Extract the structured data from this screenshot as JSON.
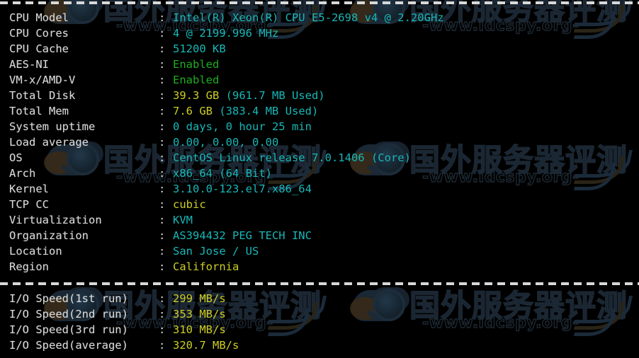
{
  "terminal": {
    "background_color": "#000000",
    "label_color": "#d9d9d9",
    "separator_char": "-",
    "colors": {
      "cyan": "#18b7b7",
      "green": "#1fae1f",
      "yellow": "#cdcd24",
      "white": "#d9d9d9"
    }
  },
  "watermark": {
    "chinese_text": "国外服务器评测",
    "url_text": "-www.idcspy.org-"
  },
  "system_info": {
    "separator_label": "dashed-separator",
    "rows": [
      {
        "label": "CPU Model",
        "separator": ":",
        "value": "Intel(R) Xeon(R) CPU E5-2698 v4 @ 2.20GHz",
        "color": "cyan"
      },
      {
        "label": "CPU Cores",
        "separator": ":",
        "value": "4 @ 2199.996 MHz",
        "color": "cyan"
      },
      {
        "label": "CPU Cache",
        "separator": ":",
        "value": "51200 KB",
        "color": "cyan"
      },
      {
        "label": "AES-NI",
        "separator": ":",
        "value": "Enabled",
        "color": "green"
      },
      {
        "label": "VM-x/AMD-V",
        "separator": ":",
        "value": "Enabled",
        "color": "green"
      },
      {
        "label": "Total Disk",
        "separator": ":",
        "value": "39.3 GB (961.7 MB Used)",
        "color": "yellow-cyan",
        "value_primary": "39.3 GB",
        "value_secondary": "(961.7 MB Used)"
      },
      {
        "label": "Total Mem",
        "separator": ":",
        "value": "7.6 GB (383.4 MB Used)",
        "color": "yellow-cyan",
        "value_primary": "7.6 GB",
        "value_secondary": "(383.4 MB Used)"
      },
      {
        "label": "System uptime",
        "separator": ":",
        "value": "0 days, 0 hour 25 min",
        "color": "cyan"
      },
      {
        "label": "Load average",
        "separator": ":",
        "value": "0.00, 0.00, 0.00",
        "color": "cyan"
      },
      {
        "label": "OS",
        "separator": ":",
        "value": "CentOS Linux release 7.0.1406 (Core)",
        "color": "cyan"
      },
      {
        "label": "Arch",
        "separator": ":",
        "value": "x86_64 (64 Bit)",
        "color": "cyan"
      },
      {
        "label": "Kernel",
        "separator": ":",
        "value": "3.10.0-123.el7.x86_64",
        "color": "cyan"
      },
      {
        "label": "TCP CC",
        "separator": ":",
        "value": "cubic",
        "color": "yellow"
      },
      {
        "label": "Virtualization",
        "separator": ":",
        "value": "KVM",
        "color": "cyan"
      },
      {
        "label": "Organization",
        "separator": ":",
        "value": "AS394432 PEG TECH INC",
        "color": "cyan"
      },
      {
        "label": "Location",
        "separator": ":",
        "value": "San Jose / US",
        "color": "cyan"
      },
      {
        "label": "Region",
        "separator": ":",
        "value": "California",
        "color": "yellow"
      }
    ]
  },
  "io_speed": {
    "rows": [
      {
        "label": "I/O Speed(1st run)",
        "separator": ":",
        "value": "299 MB/s",
        "color": "yellow"
      },
      {
        "label": "I/O Speed(2nd run)",
        "separator": ":",
        "value": "353 MB/s",
        "color": "yellow"
      },
      {
        "label": "I/O Speed(3rd run)",
        "separator": ":",
        "value": "310 MB/s",
        "color": "yellow"
      },
      {
        "label": "I/O Speed(average)",
        "separator": ":",
        "value": "320.7 MB/s",
        "color": "yellow"
      }
    ]
  }
}
